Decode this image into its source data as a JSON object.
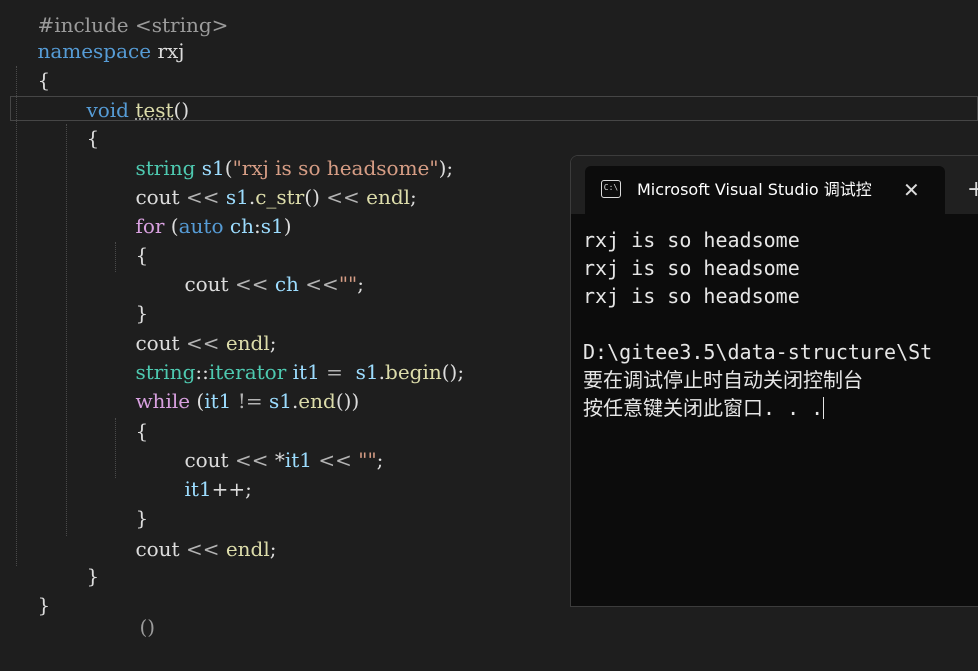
{
  "editor": {
    "line_prev": "#include <string>",
    "namespace_kw": "namespace",
    "namespace_name": "rxj",
    "open_brace": "{",
    "close_brace": "}",
    "void_kw": "void",
    "func_name": "test",
    "func_parens": "()",
    "string_type": "string",
    "s1": "s1",
    "s1_init_open": "(",
    "s1_init_str": "\"rxj is so headsome\"",
    "s1_init_close": ");",
    "cout": "cout",
    "endl": "endl",
    "lshift": " << ",
    "dot": ".",
    "c_str": "c_str",
    "call_parens": "()",
    "semicolon": ";",
    "for_kw": "for",
    "auto_kw": "auto",
    "ch": "ch",
    "for_open": " (",
    "colon": ":",
    "for_close": ")",
    "empty_str": "\"\"",
    "iterator_scope": "::",
    "iterator": "iterator",
    "it1": "it1",
    "assign": " =  ",
    "begin": "begin",
    "while_kw": "while",
    "neq": " != ",
    "end": "end",
    "deref": "*",
    "incr": "++",
    "last_line_partial": "()"
  },
  "terminal": {
    "icon_label": "C:\\",
    "tab_title": "Microsoft Visual Studio 调试控",
    "close_glyph": "✕",
    "add_glyph": "+",
    "output_lines": [
      "rxj is so headsome",
      "rxj is so headsome",
      "rxj is so headsome",
      "",
      "D:\\gitee3.5\\data-structure\\St",
      "要在调试停止时自动关闭控制台",
      "按任意键关闭此窗口. . ."
    ]
  },
  "colors": {
    "background": "#1e1e1e",
    "keyword": "#569cd6",
    "control": "#d8a0df",
    "type": "#4ec9b0",
    "function": "#dcdcaa",
    "variable": "#9cdcfe",
    "string": "#d69d85",
    "terminal_bg": "#0c0c0c"
  }
}
